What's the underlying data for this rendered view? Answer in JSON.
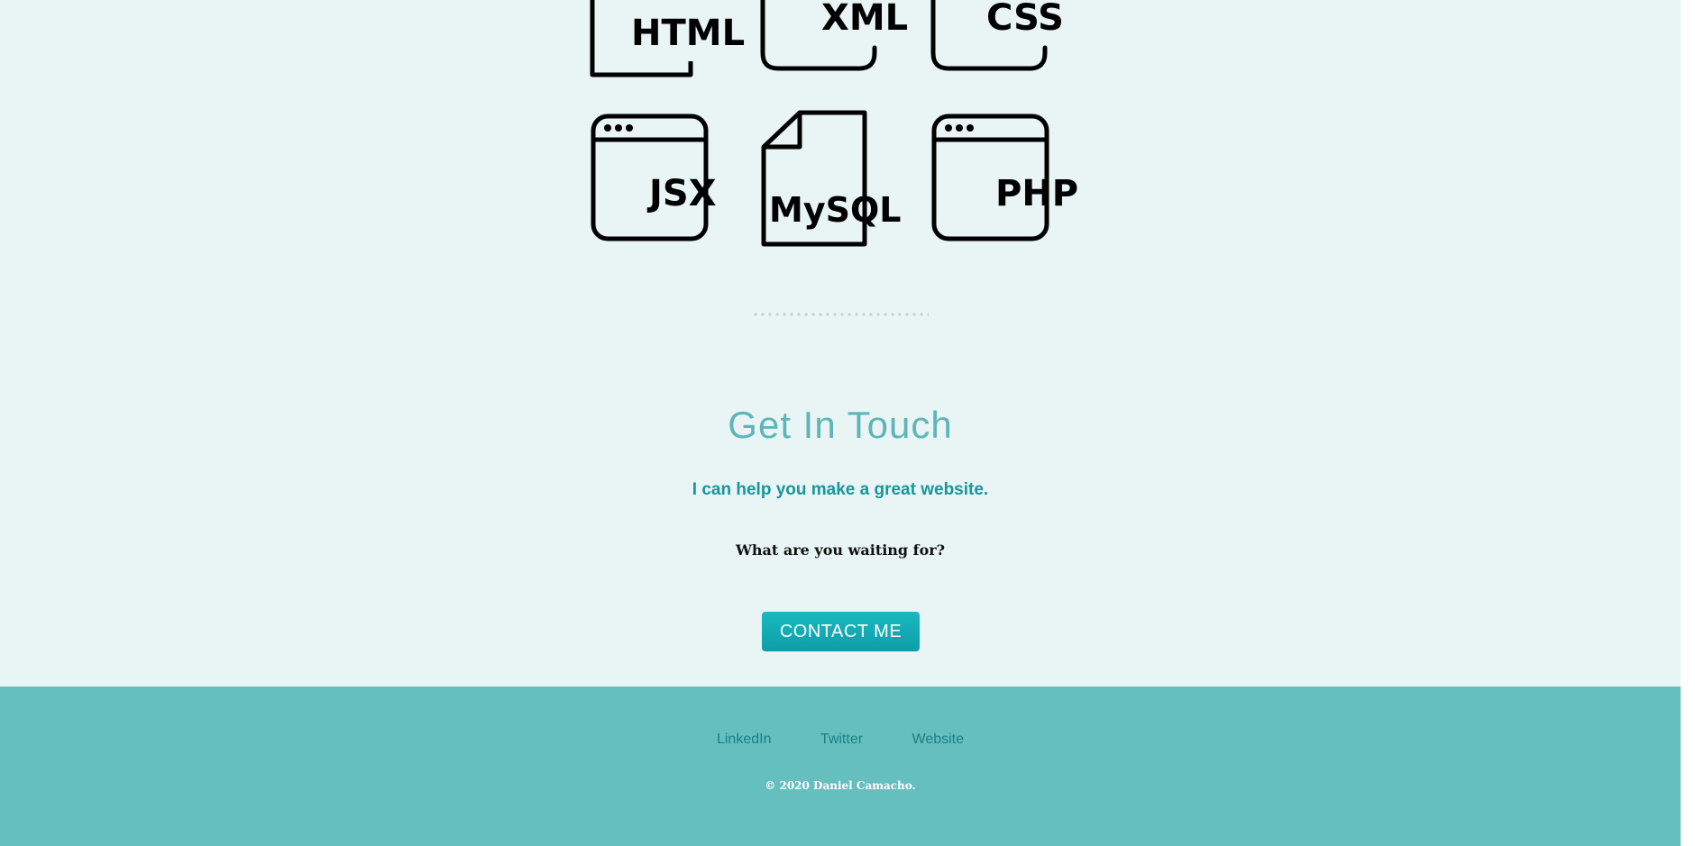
{
  "skills": {
    "html": "HTML",
    "xml": "XML",
    "css": "CSS",
    "jsx": "JSX",
    "mysql": "MySQL",
    "php": "PHP"
  },
  "contact": {
    "heading": "Get In Touch",
    "subheading": "I can help you make a great website.",
    "question": "What are you waiting for?",
    "button_label": "CONTACT ME"
  },
  "footer": {
    "links": [
      "LinkedIn",
      "Twitter",
      "Website"
    ],
    "copyright": "© 2020 Daniel Camacho."
  },
  "colors": {
    "background": "#e8f5f4",
    "heading": "#5fb5b9",
    "subheading": "#1a959d",
    "button": "#12acb4",
    "footer": "#65bfbf",
    "footer_link": "#1b7f86"
  },
  "icons": [
    "html-file-icon",
    "xml-browser-icon",
    "css-browser-icon",
    "jsx-browser-icon",
    "mysql-file-icon",
    "php-browser-icon"
  ]
}
